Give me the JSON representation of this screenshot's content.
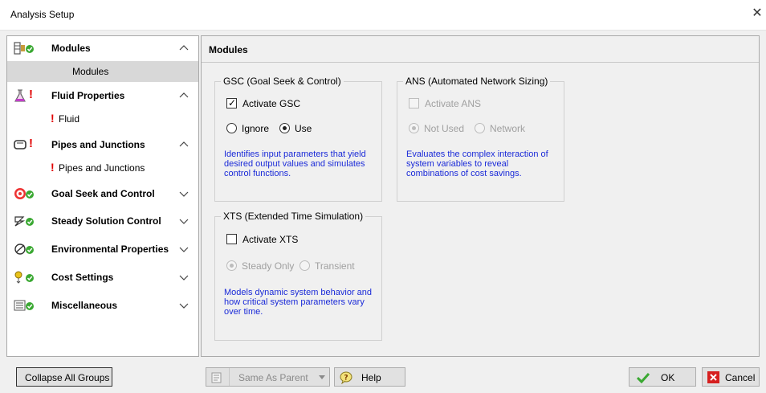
{
  "window": {
    "title": "Analysis Setup"
  },
  "sidebar": {
    "groups": [
      {
        "label": "Modules",
        "expanded": true,
        "icon": "modules-icon"
      },
      {
        "label": "Fluid Properties",
        "expanded": true,
        "icon": "flask-icon"
      },
      {
        "label": "Pipes and Junctions",
        "expanded": true,
        "icon": "pipe-icon"
      },
      {
        "label": "Goal Seek and Control",
        "expanded": false,
        "icon": "target-icon"
      },
      {
        "label": "Steady Solution Control",
        "expanded": false,
        "icon": "steady-solution-icon"
      },
      {
        "label": "Environmental Properties",
        "expanded": false,
        "icon": "environment-icon"
      },
      {
        "label": "Cost Settings",
        "expanded": false,
        "icon": "cost-icon"
      },
      {
        "label": "Miscellaneous",
        "expanded": false,
        "icon": "misc-icon"
      }
    ],
    "items": [
      {
        "label": "Modules"
      },
      {
        "label": "Fluid"
      },
      {
        "label": "Pipes and Junctions"
      }
    ],
    "warning_glyph": "!"
  },
  "panel": {
    "title": "Modules",
    "gsc": {
      "legend": "GSC (Goal Seek & Control)",
      "activate_label": "Activate GSC",
      "ignore_label": "Ignore",
      "use_label": "Use",
      "description": "Identifies input parameters that yield desired output values and simulates control functions."
    },
    "ans": {
      "legend": "ANS (Automated Network Sizing)",
      "activate_label": "Activate ANS",
      "not_used_label": "Not Used",
      "network_label": "Network",
      "description": "Evaluates the complex interaction of system variables to reveal combinations of cost savings."
    },
    "xts": {
      "legend": "XTS (Extended Time Simulation)",
      "activate_label": "Activate XTS",
      "steady_only_label": "Steady Only",
      "transient_label": "Transient",
      "description": "Models dynamic system behavior and how critical system parameters vary over time."
    }
  },
  "footer": {
    "collapse_label": "Collapse All Groups",
    "same_as_parent_label": "Same As Parent",
    "help_label": "Help",
    "ok_label": "OK",
    "cancel_label": "Cancel"
  },
  "colors": {
    "warning": "#e00000",
    "ok_check": "#3aa832",
    "cancel_x": "#d61f1f",
    "description_text": "#1a2ad8"
  }
}
